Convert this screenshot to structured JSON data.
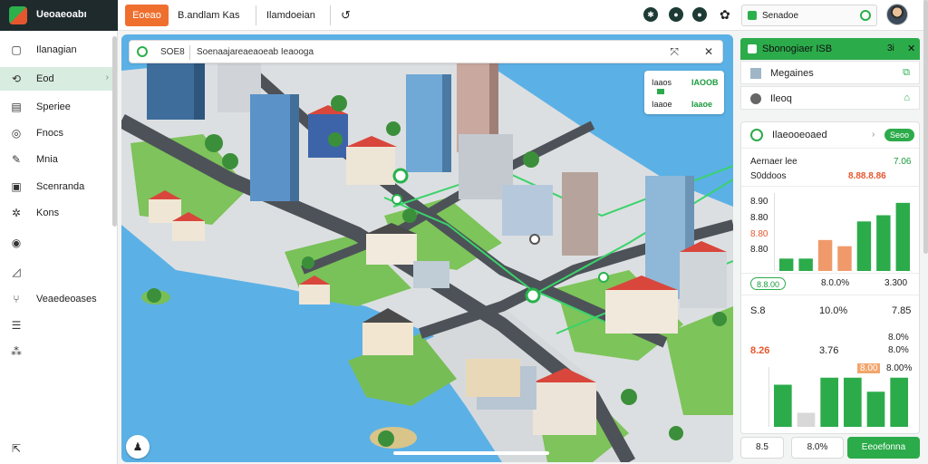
{
  "app": {
    "brand_name": "Ueoaeoabı"
  },
  "sidebar": {
    "items": [
      {
        "label": "Ilanagian",
        "icon": "box-icon"
      },
      {
        "label": "Eod",
        "icon": "route-icon"
      },
      {
        "label": "Speriee",
        "icon": "document-icon"
      },
      {
        "label": "Fnocs",
        "icon": "target-icon"
      },
      {
        "label": "Mnia",
        "icon": "pen-icon"
      },
      {
        "label": "Scenranda",
        "icon": "clipboard-icon"
      },
      {
        "label": "Kons",
        "icon": "gear-icon"
      },
      {
        "label": "",
        "icon": "pin-icon"
      },
      {
        "label": "",
        "icon": "flag-icon"
      },
      {
        "label": "Veaedeoases",
        "icon": "tree-icon"
      },
      {
        "label": "",
        "icon": "list-icon"
      },
      {
        "label": "",
        "icon": "network-icon"
      },
      {
        "label": "",
        "icon": "export-icon"
      }
    ]
  },
  "topbar": {
    "orange_button": "Eoeao",
    "title": "B.andlam Kas",
    "subtitle": "Ilamdoeian",
    "search_label": "Senadoe"
  },
  "map": {
    "search_code": "SOE8",
    "search_query": "Soenaajareaeaoeab Ieaooga",
    "legend": {
      "l1": "Iaaos",
      "r1": "IAOOB",
      "l2": "Iaaoe",
      "r2": "Iaaoe"
    }
  },
  "panel": {
    "header_title": "Sbonogiaer ISB",
    "header_key": "3i",
    "row1_label": "Megaines",
    "row2_label": "Ileoq",
    "stats": {
      "card_title": "Ilaeooeoaed",
      "card_badge": "Seoo",
      "label1": "Aernaer lee",
      "val1": "7.06",
      "label2": "S0ddoos",
      "val2": "8.88.8.86",
      "axis_ticks": [
        "8.90",
        "8.80",
        "8.80",
        "8.80"
      ],
      "pill1": "8.8.00",
      "mid1": "8.0.0%",
      "right1": "3.300",
      "row_a_left": "S.8",
      "row_a_mid": "10.0%",
      "row_a_right": "7.85",
      "row_b_left": "8.26",
      "row_b_mid": "3.76",
      "row_b_right1": "8.0%",
      "row_b_right2": "8.0%",
      "row_c_mid": "8.00",
      "row_c_right": "8.00%"
    }
  },
  "bottom": {
    "b1": "8.5",
    "b2": "8.0%",
    "primary": "Eeoefonna"
  },
  "colors": {
    "accent_green": "#2cab4b",
    "accent_orange": "#ef6f2e",
    "sidebar_active": "#d8ece0"
  },
  "chart_data": [
    {
      "type": "bar",
      "name": "upper",
      "values": [
        2,
        2,
        5,
        4,
        8,
        9,
        11
      ],
      "colors": [
        "#2cab4b",
        "#2cab4b",
        "#f09a6b",
        "#f09a6b",
        "#2cab4b",
        "#2cab4b",
        "#2cab4b"
      ],
      "ylim": [
        0,
        12
      ]
    },
    {
      "type": "bar",
      "name": "lower",
      "values": [
        6,
        2,
        7,
        7,
        5,
        7
      ],
      "colors": [
        "#2cab4b",
        "#d8d8d8",
        "#2cab4b",
        "#2cab4b",
        "#2cab4b",
        "#2cab4b"
      ],
      "ylim": [
        0,
        8
      ]
    }
  ]
}
